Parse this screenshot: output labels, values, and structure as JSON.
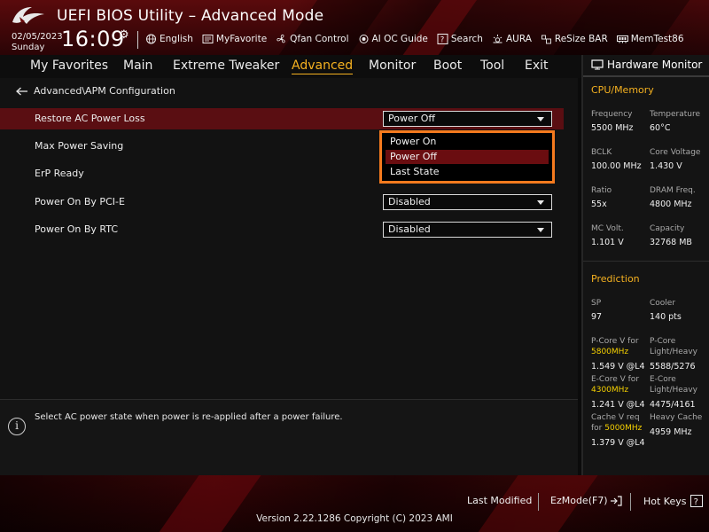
{
  "header": {
    "title": "UEFI BIOS Utility – Advanced Mode",
    "date": "02/05/2023",
    "day": "Sunday",
    "time": "16:09",
    "toolbar": [
      {
        "label": "English",
        "icon": "globe-icon"
      },
      {
        "label": "MyFavorite",
        "icon": "favorite-icon"
      },
      {
        "label": "Qfan Control",
        "icon": "fan-icon"
      },
      {
        "label": "AI OC Guide",
        "icon": "ai-icon"
      },
      {
        "label": "Search",
        "icon": "search-icon"
      },
      {
        "label": "AURA",
        "icon": "aura-icon"
      },
      {
        "label": "ReSize BAR",
        "icon": "resize-bar-icon"
      },
      {
        "label": "MemTest86",
        "icon": "memtest-icon"
      }
    ]
  },
  "tabs": [
    {
      "label": "My Favorites"
    },
    {
      "label": "Main"
    },
    {
      "label": "Extreme Tweaker"
    },
    {
      "label": "Advanced",
      "active": true
    },
    {
      "label": "Monitor"
    },
    {
      "label": "Boot"
    },
    {
      "label": "Tool"
    },
    {
      "label": "Exit"
    }
  ],
  "breadcrumb": "Advanced\\APM Configuration",
  "settings": [
    {
      "label": "Restore AC Power Loss",
      "value": "Power Off",
      "selected": true
    },
    {
      "label": "Max Power Saving",
      "value": ""
    },
    {
      "label": "ErP Ready",
      "value": ""
    },
    {
      "label": "Power On By PCI-E",
      "value": "Disabled"
    },
    {
      "label": "Power On By RTC",
      "value": "Disabled"
    }
  ],
  "dropdown": {
    "options": [
      "Power On",
      "Power Off",
      "Last State"
    ],
    "selected": "Power Off",
    "highlight_color": "#f57a1e"
  },
  "help": {
    "text": "Select AC power state when power is re-applied after a power failure."
  },
  "hwmon": {
    "title": "Hardware Monitor",
    "cpu_section": "CPU/Memory",
    "cpu": [
      {
        "label": "Frequency",
        "value": "5500 MHz"
      },
      {
        "label": "Temperature",
        "value": "60°C"
      },
      {
        "label": "BCLK",
        "value": "100.00 MHz"
      },
      {
        "label": "Core Voltage",
        "value": "1.430 V"
      },
      {
        "label": "Ratio",
        "value": "55x"
      },
      {
        "label": "DRAM Freq.",
        "value": "4800 MHz"
      },
      {
        "label": "MC Volt.",
        "value": "1.101 V"
      },
      {
        "label": "Capacity",
        "value": "32768 MB"
      }
    ],
    "prediction_section": "Prediction",
    "sp_label": "SP",
    "sp_value": "97",
    "cooler_label": "Cooler",
    "cooler_value": "140 pts",
    "pcore_label": "P-Core V for",
    "pcore_freq": "5800MHz",
    "pcore_value": "1.549 V @L4",
    "pcore_lh_label1": "P-Core",
    "pcore_lh_label2": "Light/Heavy",
    "pcore_lh_value": "5588/5276",
    "ecore_label": "E-Core V for",
    "ecore_freq": "4300MHz",
    "ecore_value": "1.241 V @L4",
    "ecore_lh_label1": "E-Core",
    "ecore_lh_label2": "Light/Heavy",
    "ecore_lh_value": "4475/4161",
    "cache_label1": "Cache V req",
    "cache_label2": "for",
    "cache_freq": "5000MHz",
    "cache_value": "1.379 V @L4",
    "heavy_cache_label": "Heavy Cache",
    "heavy_cache_value": "4959 MHz"
  },
  "footer": {
    "last_modified": "Last Modified",
    "ezmode": "EzMode(F7)",
    "hotkeys": "Hot Keys",
    "version": "Version 2.22.1286 Copyright (C) 2023 AMI"
  },
  "colors": {
    "accent": "#f5b120",
    "selection": "#5a0e12",
    "highlight_freq": "#f5d000"
  }
}
